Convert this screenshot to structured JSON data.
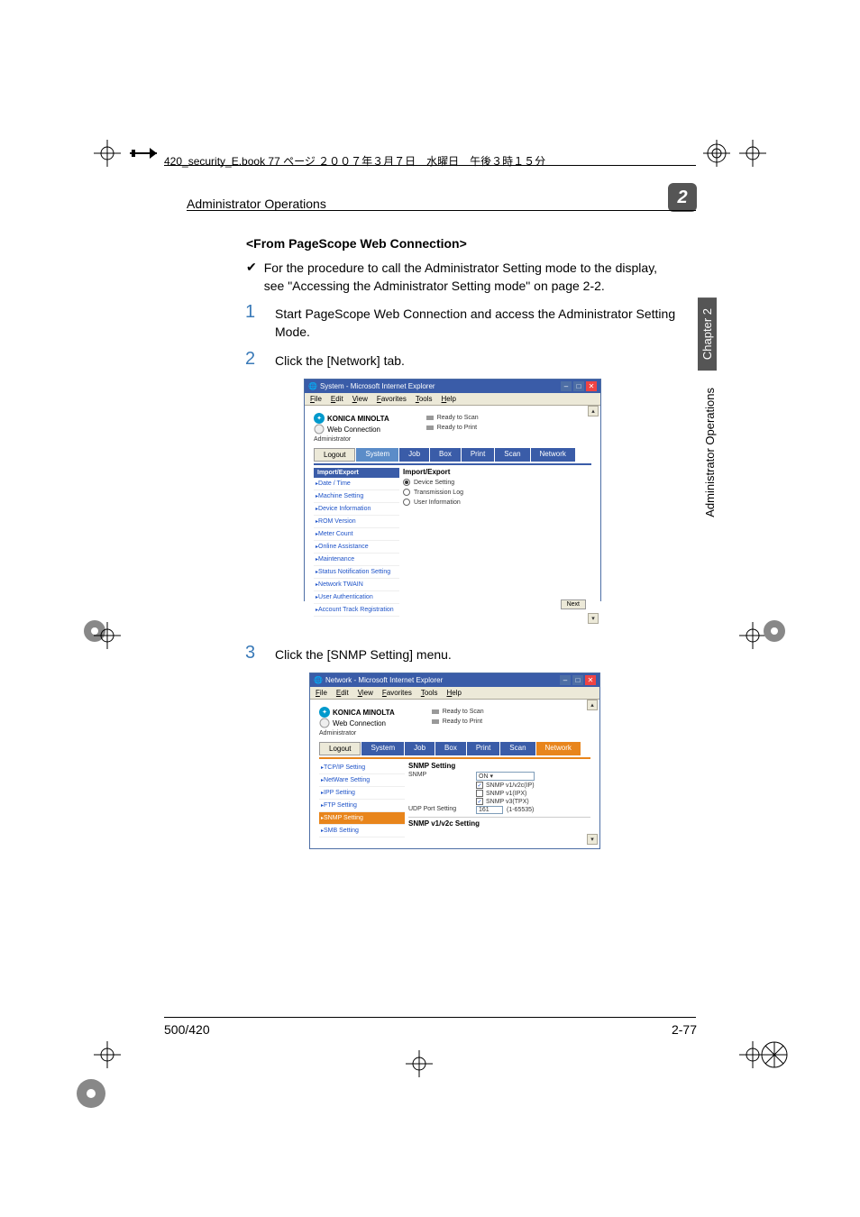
{
  "header": {
    "annotation": "420_security_E.book  77 ページ  ２００７年３月７日　水曜日　午後３時１５分",
    "section_title": "Administrator Operations",
    "chapter_num": "2"
  },
  "sidebar": {
    "chapter": "Chapter 2",
    "title": "Administrator Operations"
  },
  "content": {
    "subsection": "<From PageScope Web Connection>",
    "check_text": "For the procedure to call the Administrator Setting mode to the display, see \"Accessing the Administrator Setting mode\" on page 2-2.",
    "steps": [
      {
        "num": "1",
        "text": "Start PageScope Web Connection and access the Administrator Setting Mode."
      },
      {
        "num": "2",
        "text": "Click the [Network] tab."
      },
      {
        "num": "3",
        "text": "Click the [SNMP Setting] menu."
      }
    ]
  },
  "browser1": {
    "title": "System - Microsoft Internet Explorer",
    "menu": [
      "File",
      "Edit",
      "View",
      "Favorites",
      "Tools",
      "Help"
    ],
    "brand": "KONICA MINOLTA",
    "pagescope": "Web Connection",
    "status": [
      "Ready to Scan",
      "Ready to Print"
    ],
    "admin": "Administrator",
    "tabs": {
      "logout": "Logout",
      "system": "System",
      "job": "Job",
      "box": "Box",
      "print": "Print",
      "scan": "Scan",
      "network": "Network"
    },
    "side_header": "Import/Export",
    "side_items": [
      "Date / Time",
      "Machine Setting",
      "Device Information",
      "ROM Version",
      "Meter Count",
      "Online Assistance",
      "Maintenance",
      "Status Notification Setting",
      "Network TWAIN",
      "User Authentication",
      "Account Track Registration"
    ],
    "form_title": "Import/Export",
    "radios": [
      "Device Setting",
      "Transmission Log",
      "User Information"
    ],
    "next": "Next"
  },
  "browser2": {
    "title": "Network - Microsoft Internet Explorer",
    "menu": [
      "File",
      "Edit",
      "View",
      "Favorites",
      "Tools",
      "Help"
    ],
    "brand": "KONICA MINOLTA",
    "pagescope": "Web Connection",
    "status": [
      "Ready to Scan",
      "Ready to Print"
    ],
    "admin": "Administrator",
    "tabs": {
      "logout": "Logout",
      "system": "System",
      "job": "Job",
      "box": "Box",
      "print": "Print",
      "scan": "Scan",
      "network": "Network"
    },
    "side_items": [
      "TCP/IP Setting",
      "NetWare Setting",
      "IPP Setting",
      "FTP Setting",
      "SNMP Setting",
      "SMB Setting"
    ],
    "snmp": {
      "title": "SNMP Setting",
      "snmp_label": "SNMP",
      "snmp_value": "ON",
      "checkboxes": [
        "SNMP v1/v2c(IP)",
        "SNMP v1(IPX)",
        "SNMP v3(TPX)"
      ],
      "checked": [
        true,
        false,
        true
      ],
      "udp_label": "UDP Port Setting",
      "udp_value": "161",
      "udp_range": "(1-65535)",
      "bottom": "SNMP v1/v2c Setting"
    }
  },
  "footer": {
    "left": "500/420",
    "right": "2-77"
  }
}
